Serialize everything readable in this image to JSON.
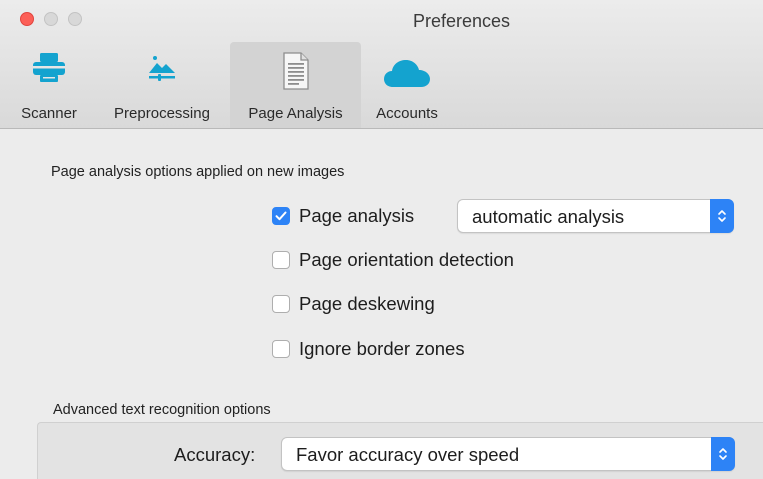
{
  "window": {
    "title": "Preferences"
  },
  "tabs": [
    {
      "label": "Scanner",
      "icon": "scanner-icon",
      "selected": false
    },
    {
      "label": "Preprocessing",
      "icon": "image-adjust-icon",
      "selected": false
    },
    {
      "label": "Page Analysis",
      "icon": "document-icon",
      "selected": true
    },
    {
      "label": "Accounts",
      "icon": "cloud-icon",
      "selected": false
    }
  ],
  "page_analysis": {
    "section_title": "Page analysis options applied on new images",
    "options": [
      {
        "label": "Page analysis",
        "checked": true
      },
      {
        "label": "Page orientation detection",
        "checked": false
      },
      {
        "label": "Page deskewing",
        "checked": false
      },
      {
        "label": "Ignore border zones",
        "checked": false
      }
    ],
    "mode_select": {
      "value": "automatic analysis"
    }
  },
  "advanced": {
    "section_title": "Advanced text recognition options",
    "accuracy_label": "Accuracy:",
    "accuracy_select": {
      "value": "Favor accuracy over speed"
    }
  },
  "colors": {
    "accent": "#2d83f6",
    "close": "#fc5f57",
    "cloud": "#14a3cf"
  }
}
